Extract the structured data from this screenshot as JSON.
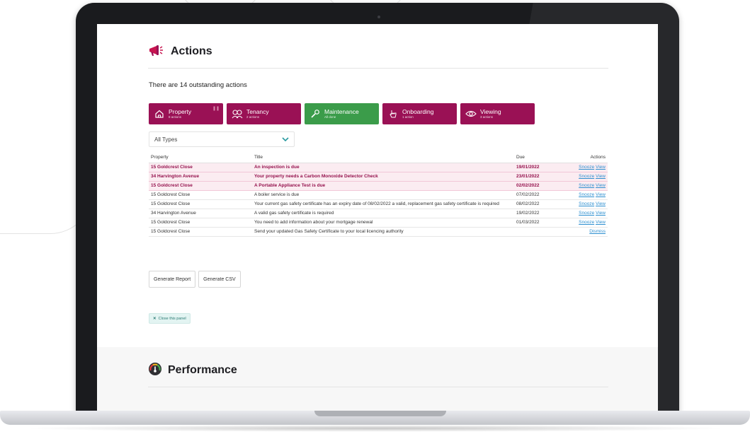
{
  "actions": {
    "title": "Actions",
    "summary": "There are 14 outstanding actions",
    "tiles": [
      {
        "name": "Property",
        "sub": "8 actions",
        "color": "#9a1155",
        "icon": "home-icon"
      },
      {
        "name": "Tenancy",
        "sub": "2 actions",
        "color": "#9a1155",
        "icon": "tenants-icon"
      },
      {
        "name": "Maintenance",
        "sub": "All done",
        "color": "#3b9c4a",
        "icon": "wrench-icon"
      },
      {
        "name": "Onboarding",
        "sub": "1 action",
        "color": "#9a1155",
        "icon": "pointer-hand-icon"
      },
      {
        "name": "Viewing",
        "sub": "3 actions",
        "color": "#9a1155",
        "icon": "eye-icon"
      }
    ],
    "filter": {
      "selected": "All Types"
    },
    "table": {
      "headers": {
        "property": "Property",
        "title": "Title",
        "due": "Due",
        "actions": "Actions"
      },
      "rows": [
        {
          "property": "15 Goldcrest Close",
          "title": "An inspection is due",
          "due": "19/01/2022",
          "snooze": "Snooze",
          "view": "View",
          "dismiss": ""
        },
        {
          "property": "34 Harvington Avenue",
          "title": "Your property needs a Carbon Monoxide Detector Check",
          "due": "23/01/2022",
          "snooze": "Snooze",
          "view": "View",
          "dismiss": ""
        },
        {
          "property": "15 Goldcrest Close",
          "title": "A Portable Appliance Test is due",
          "due": "02/02/2022",
          "snooze": "Snooze",
          "view": "View",
          "dismiss": ""
        },
        {
          "property": "15 Goldcrest Close",
          "title": "A boiler service is due",
          "due": "07/02/2022",
          "snooze": "Snooze",
          "view": "View",
          "dismiss": ""
        },
        {
          "property": "15 Goldcrest Close",
          "title": "Your current gas safety certificate has an expiry date of 08/02/2022 a valid, replacement gas safety certificate is required",
          "due": "08/02/2022",
          "snooze": "Snooze",
          "view": "View",
          "dismiss": ""
        },
        {
          "property": "34 Harvington Avenue",
          "title": "A valid gas safety certificate is required",
          "due": "19/02/2022",
          "snooze": "Snooze",
          "view": "View",
          "dismiss": ""
        },
        {
          "property": "15 Goldcrest Close",
          "title": "You need to add information about your mortgage renewal",
          "due": "01/03/2022",
          "snooze": "Snooze",
          "view": "View",
          "dismiss": ""
        },
        {
          "property": "15 Goldcrest Close",
          "title": "Send your updated Gas Safety Certificate to your local licencing authority",
          "due": "",
          "snooze": "",
          "view": "",
          "dismiss": "Dismiss"
        }
      ]
    },
    "buttons": {
      "report": "Generate Report",
      "csv": "Generate CSV"
    },
    "close_panel": "Close this panel"
  },
  "performance": {
    "title": "Performance"
  },
  "colors": {
    "brand": "#9a1155",
    "maintenance": "#3b9c4a",
    "link": "#2d8fd0"
  }
}
